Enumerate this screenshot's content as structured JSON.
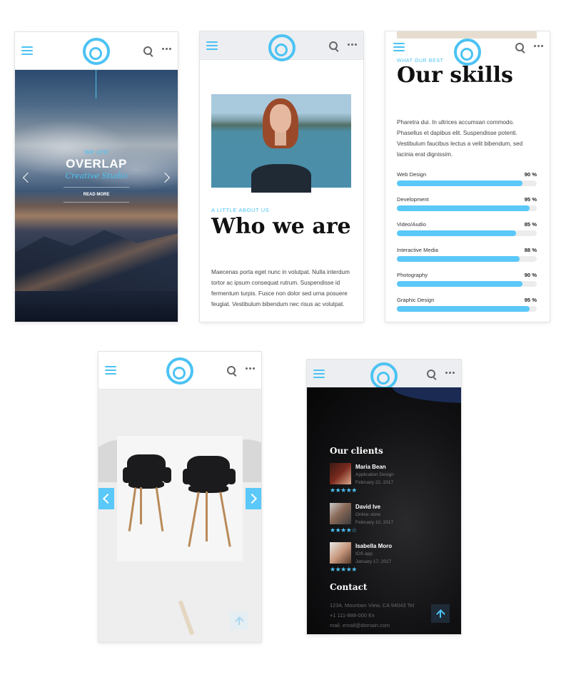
{
  "phones": {
    "overlap": {
      "we_are": "we are",
      "title": "OVERLAP",
      "subtitle": "Creative Studio",
      "read_more": "READ MORE"
    },
    "about": {
      "kicker": "A LITTLE ABOUT US",
      "title": "Who we are",
      "text": "Maecenas porta eget nunc in volutpat. Nulla interdum tortor ac ipsum consequat rutrum. Suspendisse id fermentum turpis. Fusce non dolor sed urna posuere feugiat. Vestibulum bibendum nec risus ac volutpat."
    },
    "skills": {
      "kicker": "WHAT OUR BEST",
      "title": "Our skills",
      "text": "Pharetra dui. In ultrices accumsan commodo. Phasellus et dapibus elit. Suspendisse potenti. Vestibulum faucibus lectus a velit bibendum, sed lacinia erat dignissim.",
      "items": [
        {
          "label": "Web Design",
          "value": 90,
          "text": "90 %"
        },
        {
          "label": "Development",
          "value": 95,
          "text": "95 %"
        },
        {
          "label": "Video/Audio",
          "value": 85,
          "text": "85 %"
        },
        {
          "label": "Interactive Media",
          "value": 88,
          "text": "88 %"
        },
        {
          "label": "Photography",
          "value": 90,
          "text": "90 %"
        },
        {
          "label": "Graphic Design",
          "value": 95,
          "text": "95 %"
        }
      ]
    },
    "clients": {
      "title": "Our clients",
      "items": [
        {
          "name": "Maria Bean",
          "role": "Application Design",
          "date": "February 22, 2017",
          "rating": 5,
          "stars": "★★★★★"
        },
        {
          "name": "David Ive",
          "role": "Online store",
          "date": "February 10, 2017",
          "rating": 4,
          "stars": "★★★★☆"
        },
        {
          "name": "Isabella Moro",
          "role": "IOS app",
          "date": "January 17, 2017",
          "rating": 5,
          "stars": "★★★★★"
        }
      ],
      "contact_title": "Contact",
      "address": "1234, Mountain View, CA 94043 Tel",
      "phone": "+1 111-888-000 Ex",
      "email": "mail. email@domain.com"
    }
  },
  "colors": {
    "accent": "#4cc3f3",
    "bar": "#5ac8f8",
    "heading": "#111111",
    "text": "#444444",
    "dark_bg": "#0b0b0c"
  },
  "icons": [
    "menu-icon",
    "logo-icon",
    "search-icon",
    "more-icon",
    "chevron-left-icon",
    "chevron-right-icon",
    "arrow-up-icon",
    "star-icon"
  ]
}
